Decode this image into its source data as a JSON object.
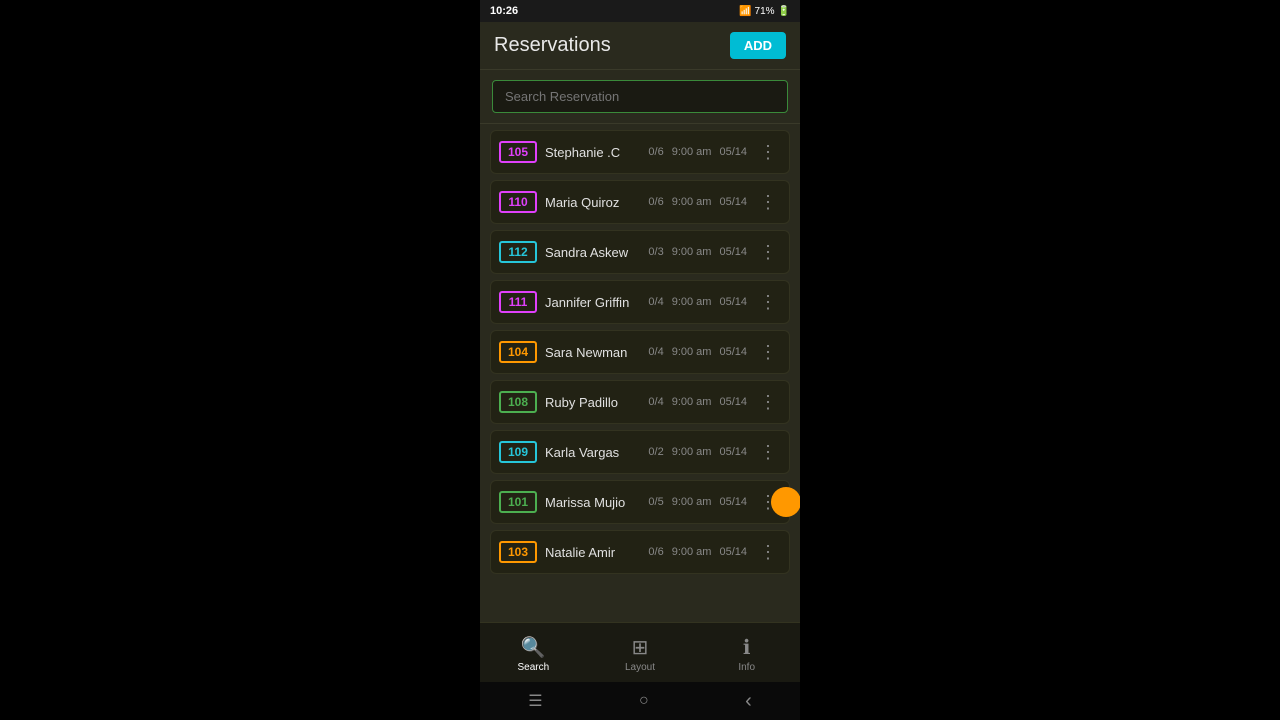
{
  "statusBar": {
    "time": "10:26",
    "batteryPercent": "71%"
  },
  "header": {
    "title": "Reservations",
    "addLabel": "ADD"
  },
  "search": {
    "placeholder": "Search Reservation"
  },
  "reservations": [
    {
      "id": 1,
      "room": "105",
      "badgeColor": "pink",
      "name": "Stephanie .C",
      "count": "0/6",
      "time": "9:00 am",
      "date": "05/14"
    },
    {
      "id": 2,
      "room": "110",
      "badgeColor": "pink",
      "name": "Maria Quiroz",
      "count": "0/6",
      "time": "9:00 am",
      "date": "05/14"
    },
    {
      "id": 3,
      "room": "112",
      "badgeColor": "teal",
      "name": "Sandra Askew",
      "count": "0/3",
      "time": "9:00 am",
      "date": "05/14"
    },
    {
      "id": 4,
      "room": "111",
      "badgeColor": "pink",
      "name": "Jannifer Griffin",
      "count": "0/4",
      "time": "9:00 am",
      "date": "05/14"
    },
    {
      "id": 5,
      "room": "104",
      "badgeColor": "orange",
      "name": "Sara Newman",
      "count": "0/4",
      "time": "9:00 am",
      "date": "05/14"
    },
    {
      "id": 6,
      "room": "108",
      "badgeColor": "green",
      "name": "Ruby Padillo",
      "count": "0/4",
      "time": "9:00 am",
      "date": "05/14"
    },
    {
      "id": 7,
      "room": "109",
      "badgeColor": "teal",
      "name": "Karla Vargas",
      "count": "0/2",
      "time": "9:00 am",
      "date": "05/14"
    },
    {
      "id": 8,
      "room": "101",
      "badgeColor": "green",
      "name": "Marissa Mujio",
      "count": "0/5",
      "time": "9:00 am",
      "date": "05/14",
      "hasDot": true
    },
    {
      "id": 9,
      "room": "103",
      "badgeColor": "orange",
      "name": "Natalie Amir",
      "count": "0/6",
      "time": "9:00 am",
      "date": "05/14"
    }
  ],
  "bottomNav": [
    {
      "label": "Search",
      "icon": "🔍",
      "active": true
    },
    {
      "label": "Layout",
      "icon": "⊞",
      "active": false
    },
    {
      "label": "Info",
      "icon": "ℹ",
      "active": false
    }
  ],
  "androidNav": {
    "menu": "☰",
    "home": "○",
    "back": "‹"
  }
}
